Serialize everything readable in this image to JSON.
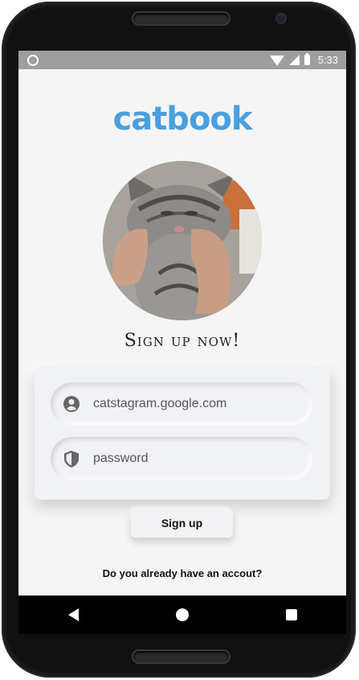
{
  "status_bar": {
    "time": "5:33"
  },
  "app": {
    "logo_text": "catbook"
  },
  "signup": {
    "heading": "Sign up now!",
    "email_value": "catstagram.google.com",
    "password_placeholder": "password",
    "button_label": "Sign up",
    "already_text": "Do you already have an accout?"
  },
  "colors": {
    "brand": "#4a9fe0",
    "background": "#f5f5f5",
    "status_bar": "#9e9e9e"
  },
  "icons": {
    "account": "account-circle-icon",
    "password": "shield-icon",
    "back": "back-triangle-icon",
    "home": "home-circle-icon",
    "recents": "recents-square-icon"
  }
}
